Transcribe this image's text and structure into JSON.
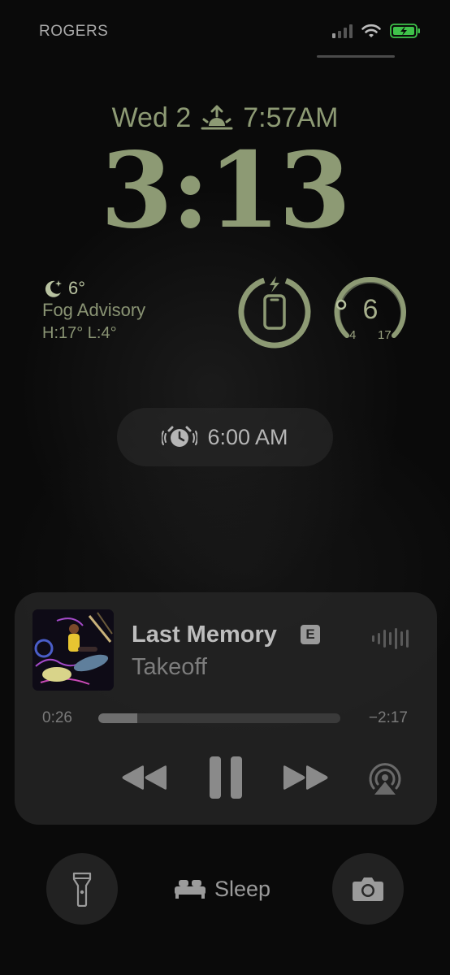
{
  "status_bar": {
    "carrier": "ROGERS",
    "icons": [
      "signal-icon",
      "wifi-icon",
      "battery-charging-icon"
    ],
    "battery_color": "#3fc24a"
  },
  "lock_screen": {
    "date": "Wed 2",
    "sunrise_icon": "sunrise-icon",
    "sunrise_time": "7:57AM",
    "time": "3:13",
    "accent_color": "#8d9a74"
  },
  "widgets": {
    "weather": {
      "icon": "moon-icon",
      "temperature": "6°",
      "condition": "Fog Advisory",
      "high_low": "H:17° L:4°"
    },
    "battery": {
      "icon": "iphone-icon",
      "charging_icon": "bolt-icon"
    },
    "temp_gauge": {
      "current": "6",
      "min": "4",
      "max": "17"
    }
  },
  "alarm": {
    "icon": "alarm-clock-icon",
    "time": "6:00 AM"
  },
  "now_playing": {
    "title": "Last Memory",
    "explicit_badge": "E",
    "artist": "Takeoff",
    "elapsed": "0:26",
    "remaining": "−2:17",
    "progress": 0.16,
    "controls": [
      "rewind-icon",
      "pause-icon",
      "fast-forward-icon",
      "airplay-icon"
    ],
    "waveform_icon": "waveform-icon"
  },
  "bottom": {
    "flashlight_icon": "flashlight-icon",
    "sleep_icon": "bed-icon",
    "sleep_label": "Sleep",
    "camera_icon": "camera-icon"
  }
}
